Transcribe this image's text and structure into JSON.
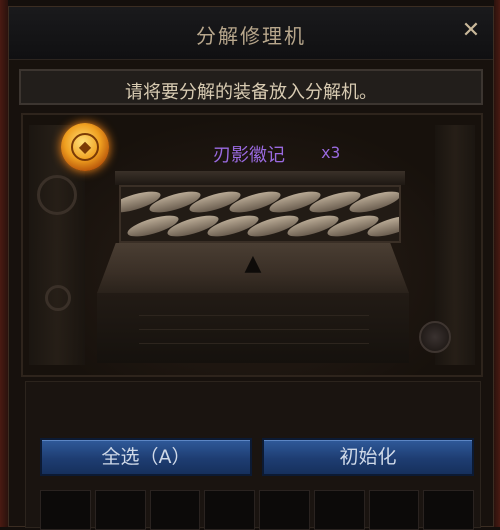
{
  "window": {
    "title": "分解修理机",
    "close_label": "✕"
  },
  "hint": "请将要分解的装备放入分解机。",
  "machine": {
    "item_name": "刃影徽记",
    "item_count": "x3",
    "arrow_icon": "arrow-up-icon",
    "coin_icon": "gold-coin-icon"
  },
  "buttons": {
    "select_all": "全选（A）",
    "reset": "初始化"
  },
  "colors": {
    "item_rarity": "#9a6ae0",
    "button": "#2f5a9a",
    "title_text": "#b8a78c"
  }
}
